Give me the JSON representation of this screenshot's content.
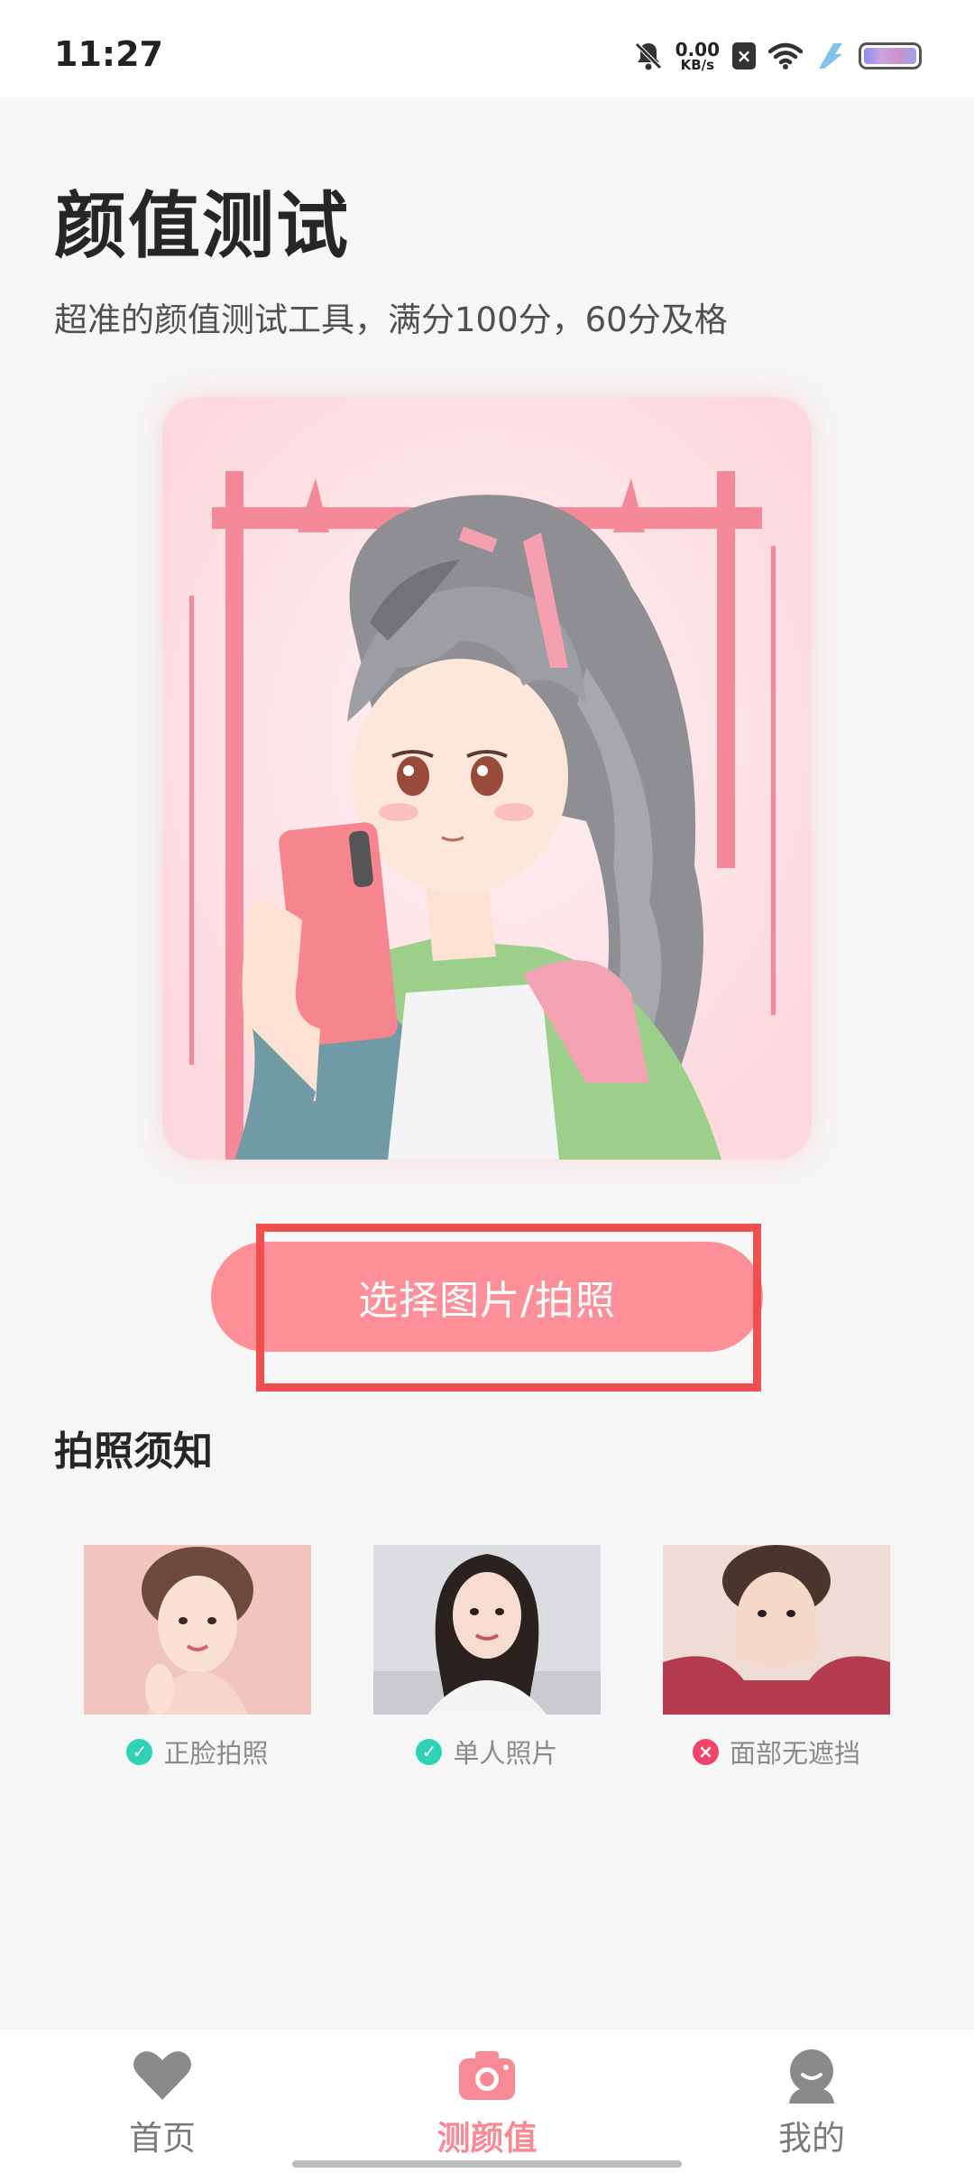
{
  "status_bar": {
    "time": "11:27",
    "net_speed_value": "0.00",
    "net_speed_unit": "KB/s",
    "icons": [
      "mute-bell-icon",
      "sim-x-icon",
      "wifi-icon",
      "charging-bolt-icon",
      "battery-icon"
    ]
  },
  "header": {
    "title": "颜值测试",
    "subtitle": "超准的颜值测试工具，满分100分，60分及格"
  },
  "hero": {
    "illustration": "anime-girl-selfie-illustration"
  },
  "actions": {
    "select_photo_label": "选择图片/拍照"
  },
  "tips": {
    "title": "拍照须知",
    "items": [
      {
        "label": "正脸拍照",
        "status": "ok",
        "icon": "check-icon"
      },
      {
        "label": "单人照片",
        "status": "ok",
        "icon": "check-icon"
      },
      {
        "label": "面部无遮挡",
        "status": "no",
        "icon": "cross-icon"
      }
    ]
  },
  "bottom_nav": {
    "items": [
      {
        "label": "首页",
        "icon": "heart-icon",
        "active": false
      },
      {
        "label": "测颜值",
        "icon": "camera-icon",
        "active": true
      },
      {
        "label": "我的",
        "icon": "profile-icon",
        "active": false
      }
    ]
  },
  "colors": {
    "accent": "#fd8f98",
    "active_tab": "#f88a96",
    "ok_badge": "#2fd2b8",
    "error_badge": "#f0456a",
    "highlight": "#ef4f4f"
  }
}
